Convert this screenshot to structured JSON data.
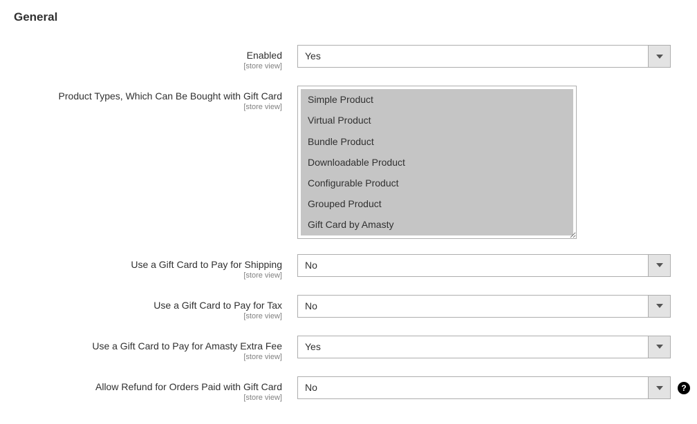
{
  "section": {
    "title": "General"
  },
  "fields": {
    "enabled": {
      "label": "Enabled",
      "scope": "[store view]",
      "value": "Yes"
    },
    "product_types": {
      "label": "Product Types, Which Can Be Bought with Gift Card",
      "scope": "[store view]",
      "options": [
        "Simple Product",
        "Virtual Product",
        "Bundle Product",
        "Downloadable Product",
        "Configurable Product",
        "Grouped Product",
        "Gift Card by Amasty"
      ]
    },
    "pay_shipping": {
      "label": "Use a Gift Card to Pay for Shipping",
      "scope": "[store view]",
      "value": "No"
    },
    "pay_tax": {
      "label": "Use a Gift Card to Pay for Tax",
      "scope": "[store view]",
      "value": "No"
    },
    "pay_extra_fee": {
      "label": "Use a Gift Card to Pay for Amasty Extra Fee",
      "scope": "[store view]",
      "value": "Yes"
    },
    "allow_refund": {
      "label": "Allow Refund for Orders Paid with Gift Card",
      "scope": "[store view]",
      "value": "No"
    }
  }
}
